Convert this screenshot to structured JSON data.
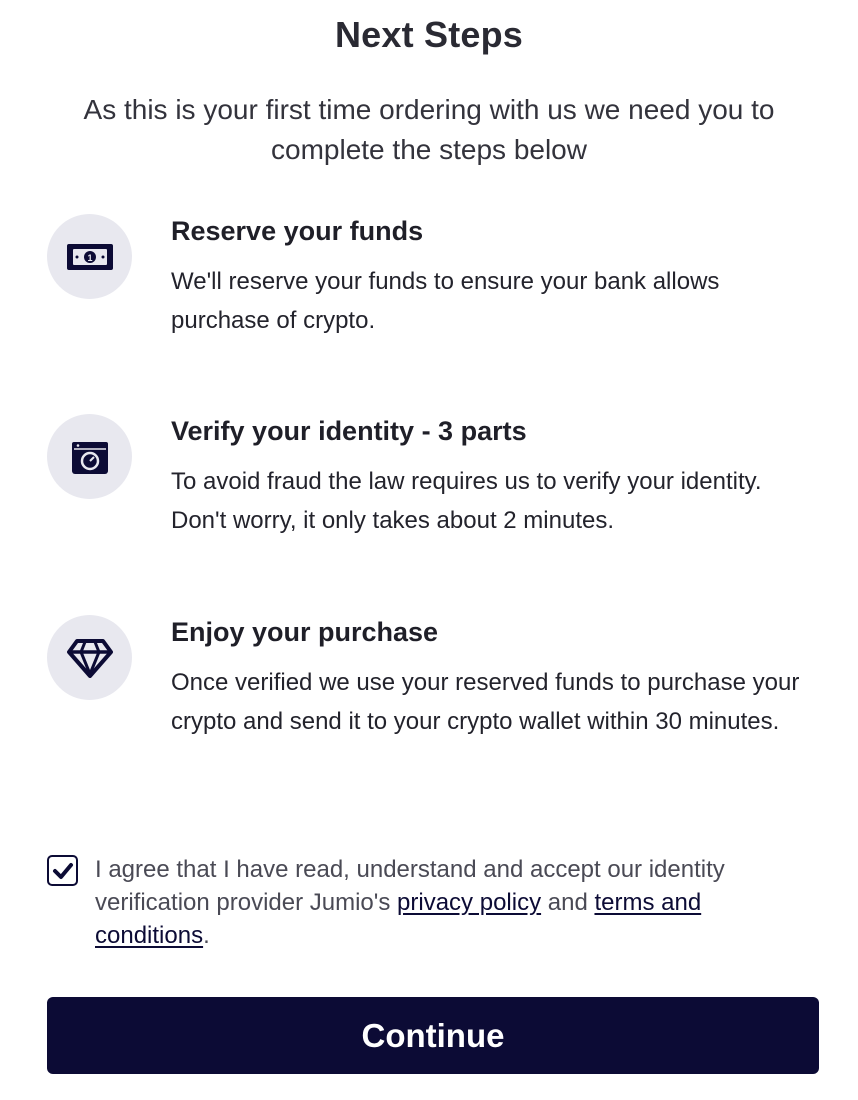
{
  "header": {
    "title": "Next Steps",
    "subtitle": "As this is your first time ordering with us we need you to complete the steps below"
  },
  "steps": [
    {
      "icon": "cash-icon",
      "title": "Reserve your funds",
      "description": "We'll reserve your funds to ensure your bank allows purchase of crypto."
    },
    {
      "icon": "camera-icon",
      "title": "Verify your identity - 3 parts",
      "description": "To avoid fraud the law requires us to verify your identity. Don't worry, it only takes about 2 minutes."
    },
    {
      "icon": "diamond-icon",
      "title": "Enjoy your purchase",
      "description": "Once verified we use your reserved funds to purchase your crypto and send it to your crypto wallet within 30 minutes."
    }
  ],
  "agreement": {
    "checked": true,
    "text_before": "I agree that I have read, understand and accept our identity verification provider Jumio's ",
    "privacy_link": "privacy policy",
    "text_middle": " and ",
    "terms_link": "terms and conditions",
    "text_after": "."
  },
  "actions": {
    "continue_label": "Continue"
  },
  "colors": {
    "primary": "#0c0b35",
    "icon_bg": "#e8e8ef"
  }
}
